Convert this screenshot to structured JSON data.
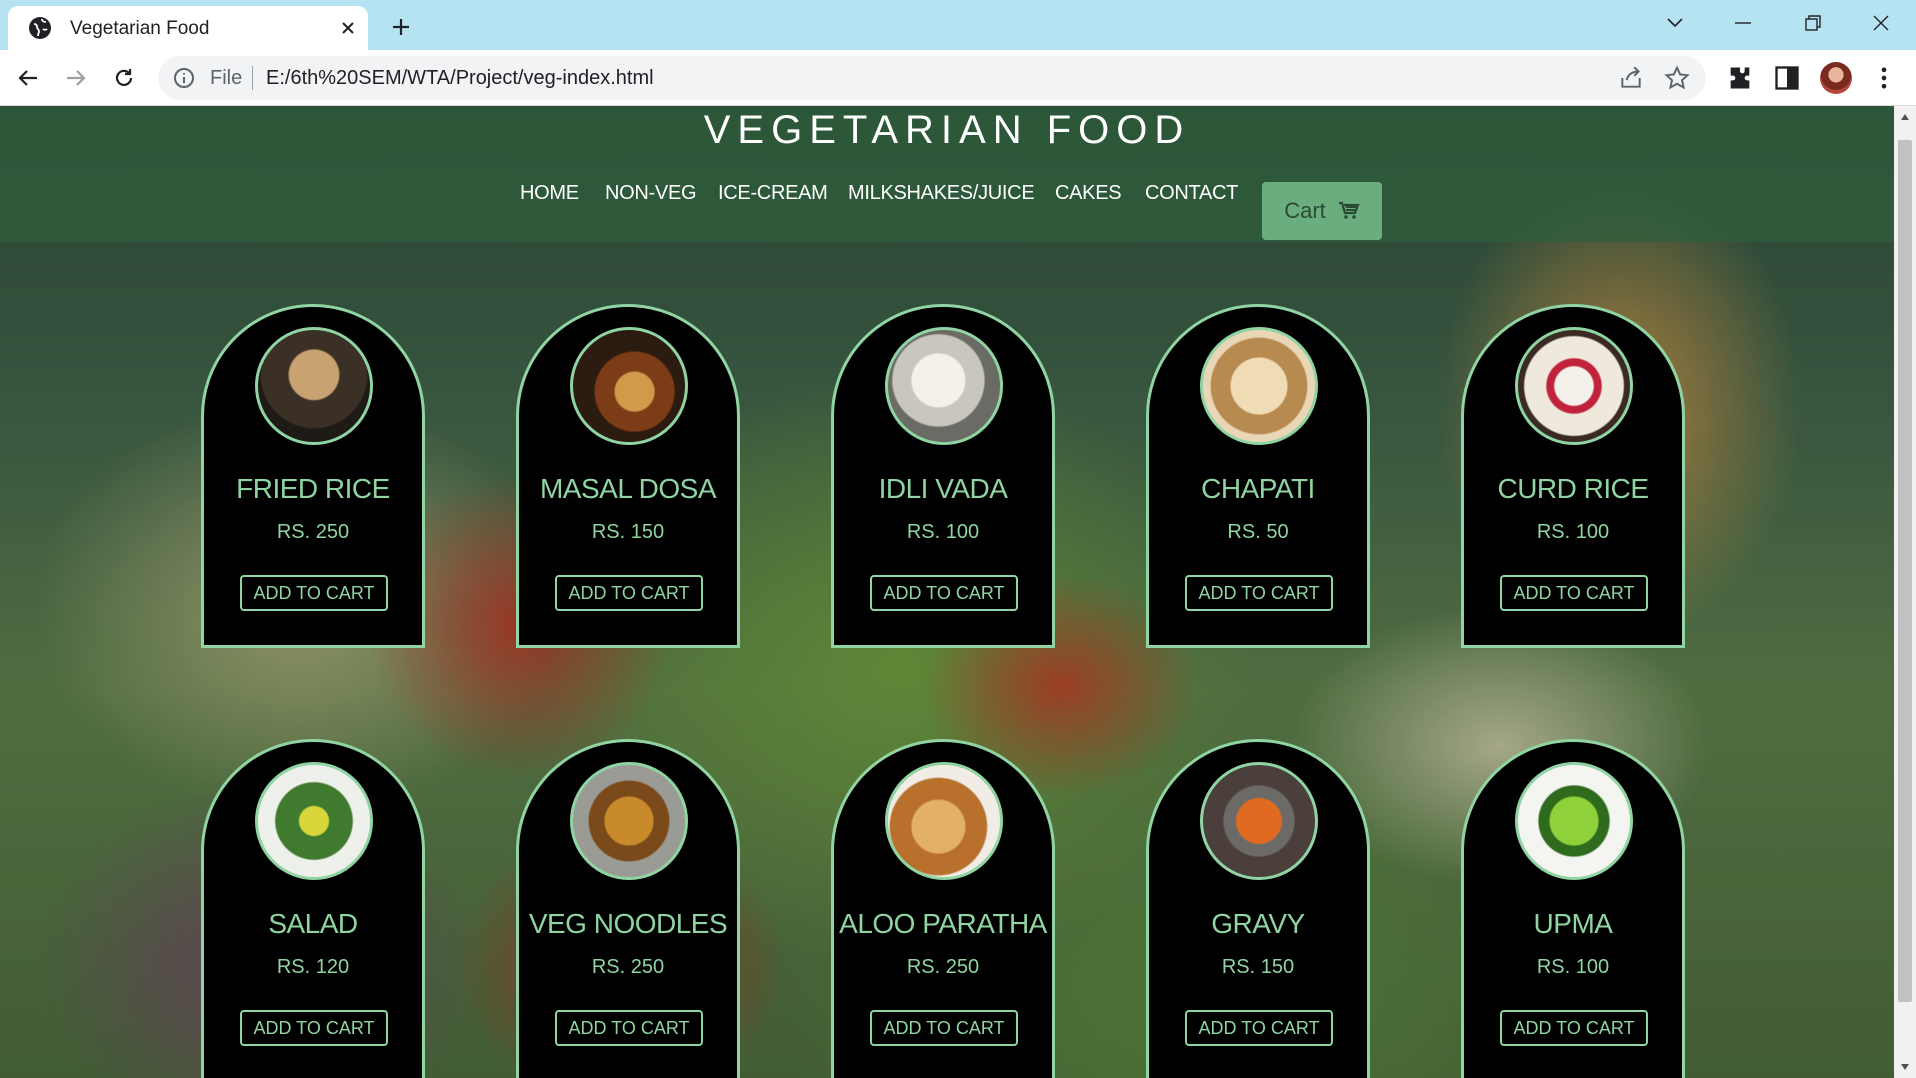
{
  "browser": {
    "tab_title": "Vegetarian Food",
    "address_scheme_label": "File",
    "address_url": "E:/6th%20SEM/WTA/Project/veg-index.html"
  },
  "site": {
    "title": "VEGETARIAN FOOD",
    "nav": [
      "HOME",
      "NON-VEG",
      "ICE-CREAM",
      "MILKSHAKES/JUICE",
      "CAKES",
      "CONTACT"
    ],
    "cart_label": "Cart"
  },
  "products": [
    {
      "name": "FRIED RICE",
      "price": "RS. 250",
      "button": "ADD TO CART"
    },
    {
      "name": "MASAL DOSA",
      "price": "RS. 150",
      "button": "ADD TO CART"
    },
    {
      "name": "IDLI VADA",
      "price": "RS. 100",
      "button": "ADD TO CART"
    },
    {
      "name": "CHAPATI",
      "price": "RS. 50",
      "button": "ADD TO CART"
    },
    {
      "name": "CURD RICE",
      "price": "RS. 100",
      "button": "ADD TO CART"
    },
    {
      "name": "SALAD",
      "price": "RS. 120",
      "button": "ADD TO CART"
    },
    {
      "name": "VEG NOODLES",
      "price": "RS. 250",
      "button": "ADD TO CART"
    },
    {
      "name": "ALOO PARATHA",
      "price": "RS. 250",
      "button": "ADD TO CART"
    },
    {
      "name": "GRAVY",
      "price": "RS. 150",
      "button": "ADD TO CART"
    },
    {
      "name": "UPMA",
      "price": "RS. 100",
      "button": "ADD TO CART"
    }
  ],
  "colors": {
    "accent": "#8fd4a2",
    "header_bg": "#2e5e3c",
    "cart_button": "#6aae7d",
    "card_bg": "#000000"
  }
}
